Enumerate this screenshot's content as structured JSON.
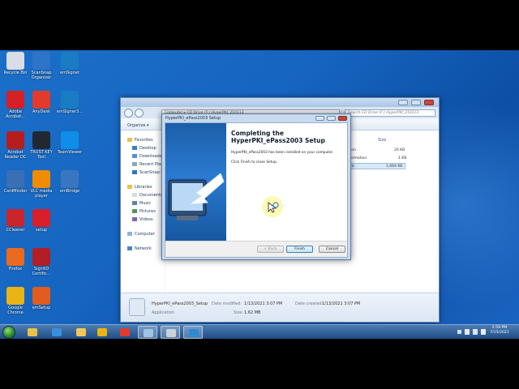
{
  "desktop": {
    "icons": [
      {
        "label": "Recycle Bin",
        "color": "#d9dee6"
      },
      {
        "label": "ScanSnap Organizer",
        "color": "#2e74c9"
      },
      {
        "label": "emSigner",
        "color": "#1a7cc2"
      },
      {
        "label": "Adobe Acrobat...",
        "color": "#d71f26"
      },
      {
        "label": "AnyDesk",
        "color": "#e23b2b"
      },
      {
        "label": "emSigner3...",
        "color": "#1a7cc2"
      },
      {
        "label": "Acrobat Reader DC",
        "color": "#b81d1d"
      },
      {
        "label": "TRUST KEY Tool",
        "color": "#222831"
      },
      {
        "label": "TeamViewer",
        "color": "#0e8ee9"
      },
      {
        "label": "CardMinder",
        "color": "#3b6fb4"
      },
      {
        "label": "VLC media player",
        "color": "#f08c00"
      },
      {
        "label": "emBridge",
        "color": "#3a76bf"
      },
      {
        "label": "CCleaner",
        "color": "#c8262b"
      },
      {
        "label": "setup",
        "color": "#d81f2a"
      },
      {
        "label": "Firefox",
        "color": "#ea6a1f"
      },
      {
        "label": "SignXD Certific...",
        "color": "#b21e25"
      },
      {
        "label": "Google Chrome",
        "color": "#e8b416"
      },
      {
        "label": "emSetup",
        "color": "#e25c1f"
      }
    ]
  },
  "explorer": {
    "address": "Computer ▸ CD Drive (F:) HyperPKI_210113",
    "search_placeholder": "Search CD Drive (F:) HyperPKI_210113",
    "toolbar": {
      "organize": "Organize ▾"
    },
    "nav": {
      "favorites": "Favorites",
      "desktop": "Desktop",
      "downloads": "Downloads",
      "recent": "Recent Places",
      "scansnap": "ScanSnap Fold...",
      "libraries": "Libraries",
      "documents": "Documents",
      "music": "Music",
      "pictures": "Pictures",
      "videos": "Videos",
      "computer": "Computer",
      "network": "Network"
    },
    "columns": {
      "size": "Size"
    },
    "rows": [
      {
        "type": "ion",
        "size": "20 KB"
      },
      {
        "type": "ormation",
        "size": "1 KB"
      },
      {
        "type": "re",
        "size": "1,664 KB"
      }
    ],
    "details": {
      "file_name": "HyperPKI_ePass2003_Setup",
      "file_type": "Application",
      "date_modified_label": "Date modified:",
      "date_modified": "1/13/2021 3:07 PM",
      "date_created_label": "Date created:",
      "date_created": "1/13/2021 3:07 PM",
      "size_label": "Size:",
      "size": "1.62 MB"
    }
  },
  "dialog": {
    "title": "HyperPKI_ePass2003 Setup",
    "heading": "Completing the HyperPKI_ePass2003 Setup",
    "message": "HyperPKI_ePass2003 has been installed on your computer.",
    "instruction": "Click Finish to close Setup.",
    "back_label": "< Back",
    "finish_label": "Finish",
    "cancel_label": "Cancel"
  },
  "taskbar": {
    "items": [
      {
        "icon": "explorer-icon",
        "color": "#e9c24a"
      },
      {
        "icon": "ie-icon",
        "color": "#3a8fdc"
      },
      {
        "icon": "folder-icon",
        "color": "#f0c85a"
      },
      {
        "icon": "chrome-icon",
        "color": "#e8b416"
      },
      {
        "icon": "anydesk-icon",
        "color": "#e23b2b"
      },
      {
        "icon": "monitor-icon",
        "color": "#9fc4e8"
      },
      {
        "icon": "setup-icon",
        "color": "#c9d2dc"
      },
      {
        "icon": "hyperpki-icon",
        "color": "#2f8ad6"
      }
    ],
    "clock_time": "2:59 PM",
    "clock_date": "7/15/2021"
  }
}
